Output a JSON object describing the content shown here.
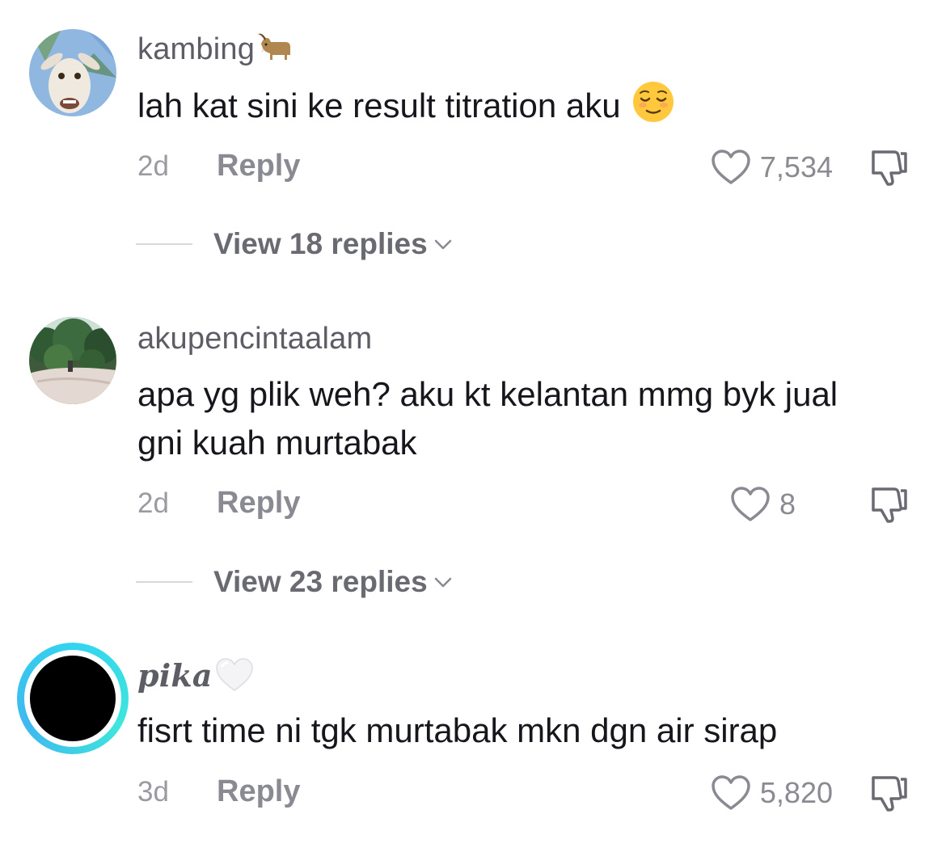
{
  "comments": [
    {
      "username": "kambing",
      "username_emoji": "goat-emoji",
      "text": "lah kat sini ke result titration aku",
      "text_emoji": "relieved-face-emoji",
      "time": "2d",
      "reply_label": "Reply",
      "likes": "7,534",
      "view_replies": "View 18 replies"
    },
    {
      "username": "akupencintaalam",
      "text": "apa yg plik weh? aku kt kelantan mmg byk jual gni kuah murtabak",
      "time": "2d",
      "reply_label": "Reply",
      "likes": "8",
      "view_replies": "View 23 replies"
    },
    {
      "username": "pika",
      "username_emoji": "white-heart-emoji",
      "text": "fisrt time ni tgk murtabak mkn dgn air sirap",
      "time": "3d",
      "reply_label": "Reply",
      "likes": "5,820"
    }
  ],
  "colors": {
    "ring": "#32d4f0",
    "username": "#5d5d66",
    "text": "#16161c",
    "meta": "#8a8a92"
  }
}
